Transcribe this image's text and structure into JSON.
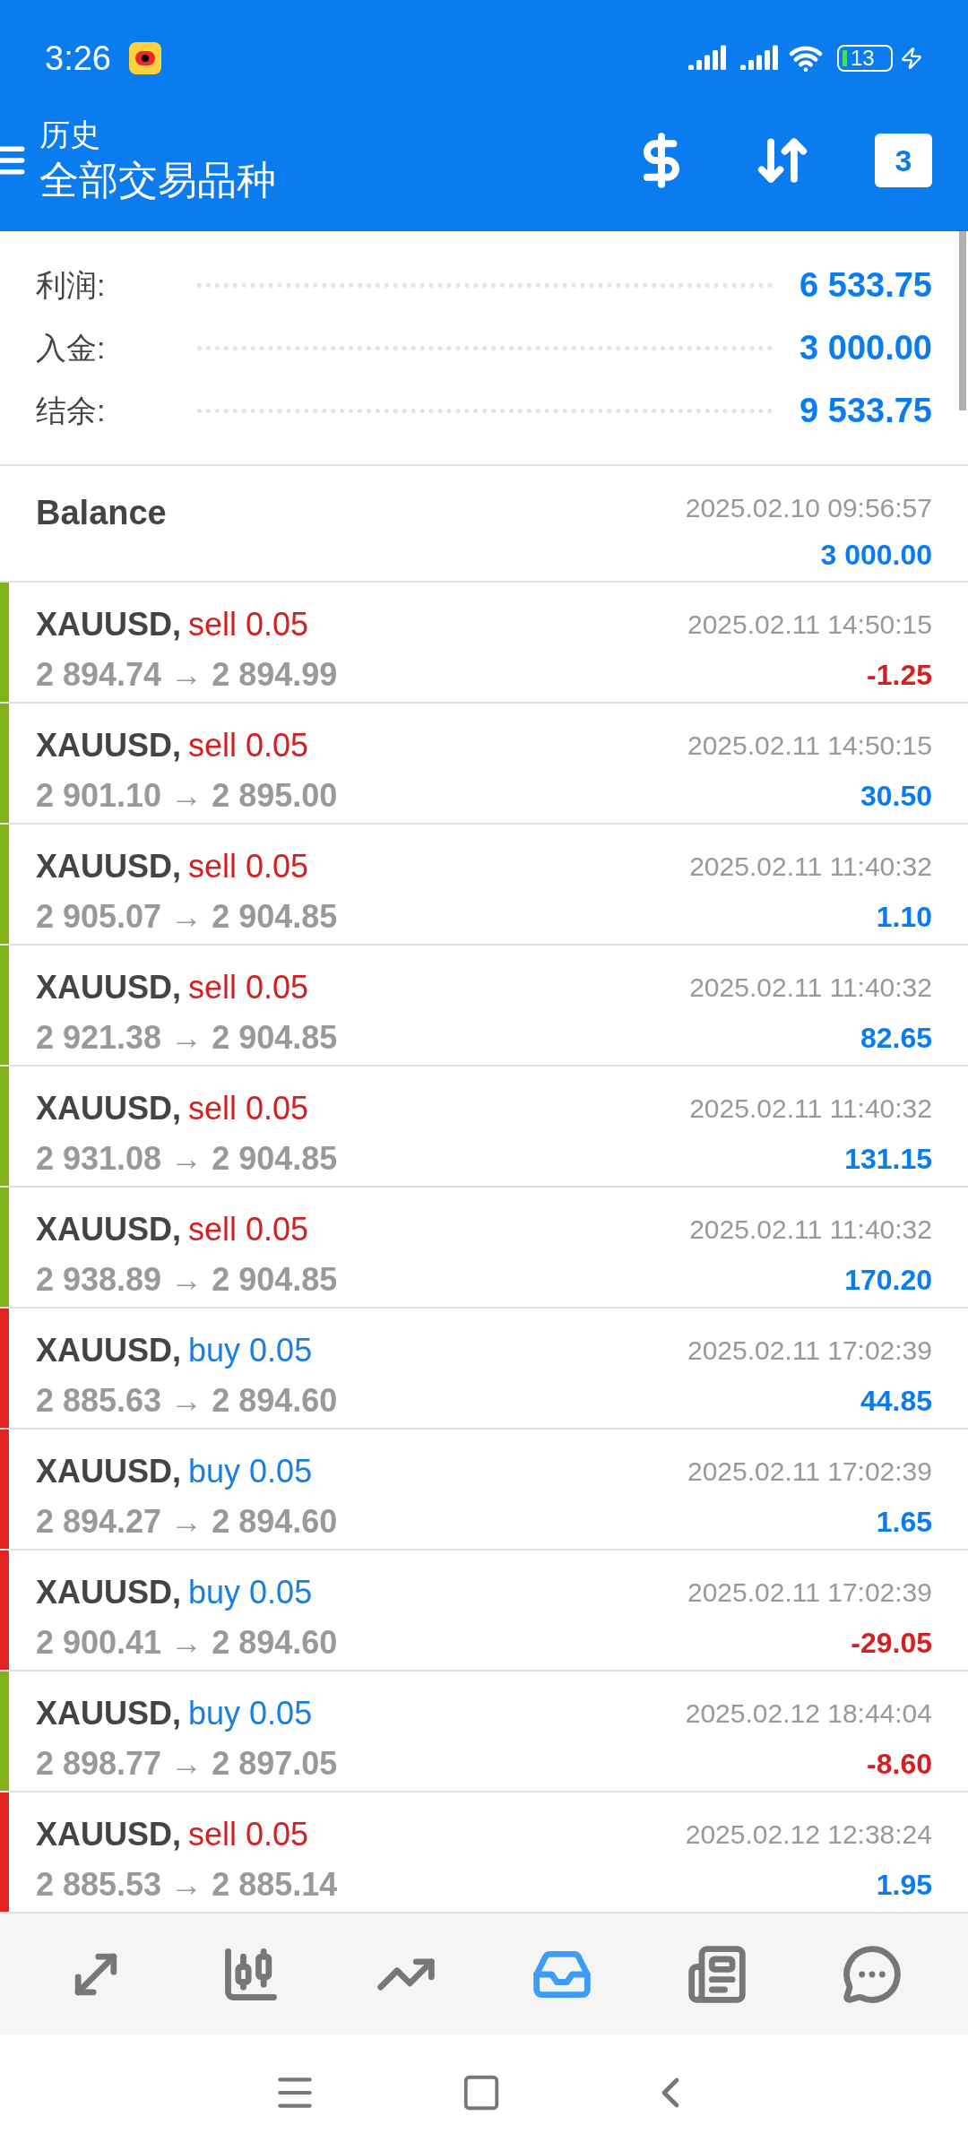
{
  "status_bar": {
    "time": "3:26",
    "battery": "13"
  },
  "header": {
    "subtitle": "历史",
    "title": "全部交易品种",
    "calendar_day": "3"
  },
  "summary": [
    {
      "label": "利润:",
      "value": "6 533.75"
    },
    {
      "label": "入金:",
      "value": "3 000.00"
    },
    {
      "label": "结余:",
      "value": "9 533.75"
    }
  ],
  "balance": {
    "label": "Balance",
    "time": "2025.02.10 09:56:57",
    "amount": "3 000.00"
  },
  "trades": [
    {
      "symbol": "XAUUSD,",
      "type": "sell",
      "volume": "0.05",
      "prices": "2 894.74 → 2 894.99",
      "time": "2025.02.11 14:50:15",
      "profit": "-1.25",
      "loss": true,
      "color": "#84b21a"
    },
    {
      "symbol": "XAUUSD,",
      "type": "sell",
      "volume": "0.05",
      "prices": "2 901.10 → 2 895.00",
      "time": "2025.02.11 14:50:15",
      "profit": "30.50",
      "loss": false,
      "color": "#84b21a"
    },
    {
      "symbol": "XAUUSD,",
      "type": "sell",
      "volume": "0.05",
      "prices": "2 905.07 → 2 904.85",
      "time": "2025.02.11 11:40:32",
      "profit": "1.10",
      "loss": false,
      "color": "#84b21a"
    },
    {
      "symbol": "XAUUSD,",
      "type": "sell",
      "volume": "0.05",
      "prices": "2 921.38 → 2 904.85",
      "time": "2025.02.11 11:40:32",
      "profit": "82.65",
      "loss": false,
      "color": "#84b21a"
    },
    {
      "symbol": "XAUUSD,",
      "type": "sell",
      "volume": "0.05",
      "prices": "2 931.08 → 2 904.85",
      "time": "2025.02.11 11:40:32",
      "profit": "131.15",
      "loss": false,
      "color": "#84b21a"
    },
    {
      "symbol": "XAUUSD,",
      "type": "sell",
      "volume": "0.05",
      "prices": "2 938.89 → 2 904.85",
      "time": "2025.02.11 11:40:32",
      "profit": "170.20",
      "loss": false,
      "color": "#84b21a"
    },
    {
      "symbol": "XAUUSD,",
      "type": "buy",
      "volume": "0.05",
      "prices": "2 885.63 → 2 894.60",
      "time": "2025.02.11 17:02:39",
      "profit": "44.85",
      "loss": false,
      "color": "#e02424"
    },
    {
      "symbol": "XAUUSD,",
      "type": "buy",
      "volume": "0.05",
      "prices": "2 894.27 → 2 894.60",
      "time": "2025.02.11 17:02:39",
      "profit": "1.65",
      "loss": false,
      "color": "#e02424"
    },
    {
      "symbol": "XAUUSD,",
      "type": "buy",
      "volume": "0.05",
      "prices": "2 900.41 → 2 894.60",
      "time": "2025.02.11 17:02:39",
      "profit": "-29.05",
      "loss": true,
      "color": "#e02424"
    },
    {
      "symbol": "XAUUSD,",
      "type": "buy",
      "volume": "0.05",
      "prices": "2 898.77 → 2 897.05",
      "time": "2025.02.12 18:44:04",
      "profit": "-8.60",
      "loss": true,
      "color": "#84b21a"
    },
    {
      "symbol": "XAUUSD,",
      "type": "sell",
      "volume": "0.05",
      "prices": "2 885.53 → 2 885.14",
      "time": "2025.02.12 12:38:24",
      "profit": "1.95",
      "loss": false,
      "color": "#e02424"
    }
  ],
  "bottom_nav": [
    {
      "kind": "quotes",
      "selected": false
    },
    {
      "kind": "chart",
      "selected": false
    },
    {
      "kind": "trade",
      "selected": false
    },
    {
      "kind": "history",
      "selected": true
    },
    {
      "kind": "news",
      "selected": false
    },
    {
      "kind": "chat",
      "selected": false
    }
  ]
}
